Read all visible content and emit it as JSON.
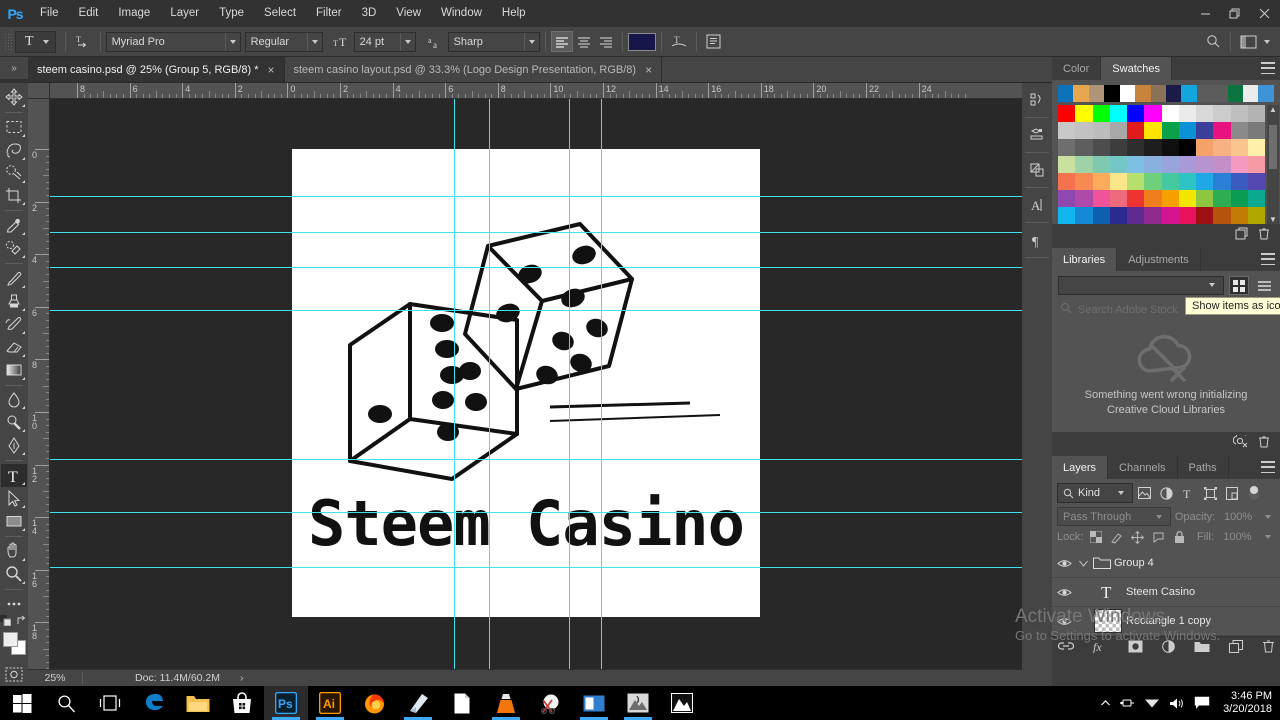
{
  "app": {
    "name": "Adobe Photoshop",
    "logo": "ps-logo"
  },
  "menubar": {
    "items": [
      "File",
      "Edit",
      "Image",
      "Layer",
      "Type",
      "Select",
      "Filter",
      "3D",
      "View",
      "Window",
      "Help"
    ]
  },
  "window_controls": {
    "minimize": "minimize-button",
    "restore": "restore-button",
    "close": "close-button"
  },
  "options_bar": {
    "tool": "T",
    "orientation_icon": "text-orientation-icon",
    "font_family": "Myriad Pro",
    "font_style": "Regular",
    "size_icon": "font-size-icon",
    "font_size": "24 pt",
    "antialias_icon": "anti-alias-icon",
    "anti_aliasing": "Sharp",
    "align": [
      "align-left",
      "align-center",
      "align-right"
    ],
    "active_align": "align-left",
    "text_color": "#16164a",
    "warp_icon": "warp-text-icon",
    "panel_icon": "character-paragraph-panels-icon",
    "search_icon": "search-icon",
    "workspace_icon": "workspace-switcher-icon"
  },
  "tabs": [
    {
      "title": "steem casino.psd @ 25% (Group 5, RGB/8) *",
      "active": true,
      "close": "×"
    },
    {
      "title": "steem casino layout.psd @ 33.3% (Logo  Design  Presentation, RGB/8)",
      "active": false,
      "close": "×"
    }
  ],
  "rulers": {
    "horizontal": [
      "8",
      "6",
      "4",
      "2",
      "0",
      "2",
      "4",
      "6",
      "8",
      "10",
      "12",
      "14",
      "16",
      "18",
      "20",
      "22",
      "24"
    ],
    "vertical": [
      "0",
      "2",
      "4",
      "6",
      "8",
      "10",
      "12",
      "14",
      "16",
      "18"
    ]
  },
  "canvas": {
    "artwork_title": "Steem Casino",
    "artwork_alt": "dice-logo"
  },
  "status_bar": {
    "zoom": "25%",
    "doc": "Doc: 11.4M/60.2M",
    "arrow": "›"
  },
  "toolbar": {
    "tools": [
      {
        "name": "move-tool",
        "glyph": "move"
      },
      {
        "name": "marquee-tool",
        "glyph": "marquee"
      },
      {
        "name": "lasso-tool",
        "glyph": "lasso"
      },
      {
        "name": "quick-selection-tool",
        "glyph": "quickselect"
      },
      {
        "name": "crop-tool",
        "glyph": "crop"
      },
      {
        "name": "eyedropper-tool",
        "glyph": "eyedropper"
      },
      {
        "name": "healing-brush-tool",
        "glyph": "heal"
      },
      {
        "name": "brush-tool",
        "glyph": "brush"
      },
      {
        "name": "clone-stamp-tool",
        "glyph": "stamp"
      },
      {
        "name": "history-brush-tool",
        "glyph": "historybrush"
      },
      {
        "name": "eraser-tool",
        "glyph": "eraser"
      },
      {
        "name": "gradient-tool",
        "glyph": "gradient"
      },
      {
        "name": "blur-tool",
        "glyph": "blur"
      },
      {
        "name": "dodge-tool",
        "glyph": "dodge"
      },
      {
        "name": "pen-tool",
        "glyph": "pen"
      },
      {
        "name": "type-tool",
        "glyph": "type",
        "active": true
      },
      {
        "name": "path-selection-tool",
        "glyph": "pathselect"
      },
      {
        "name": "rectangle-tool",
        "glyph": "rectangle"
      },
      {
        "name": "hand-tool",
        "glyph": "hand"
      },
      {
        "name": "zoom-tool",
        "glyph": "zoom"
      },
      {
        "name": "edit-toolbar-button",
        "glyph": "dots"
      }
    ],
    "swap_colors": "swap-colors-icon",
    "default_colors": "default-colors-icon",
    "quick_mask": "quick-mask-icon",
    "foreground_color": "#efefef",
    "background_color": "#ffffff"
  },
  "rail": {
    "icons": [
      "history-icon",
      "properties-icon",
      "styles-icon",
      "character-icon",
      "paragraph-icon"
    ]
  },
  "color_panel": {
    "tabs": [
      {
        "label": "Color",
        "active": false
      },
      {
        "label": "Swatches",
        "active": true
      }
    ],
    "menu": "panel-menu-icon",
    "recent": [
      "#0c72b9",
      "#e8a64f",
      "#b09477",
      "#000000",
      "#ffffff",
      "#c8833c",
      "#8a7259",
      "#1b1b4a",
      "#13a5dd",
      "#5c5c5c",
      "#5c5c5c",
      "#0c7440",
      "#ececec",
      "#3f94d8"
    ],
    "grid": [
      "#ff0000",
      "#ffff00",
      "#00ff00",
      "#00ffff",
      "#0000ff",
      "#ff00ff",
      "#ffffff",
      "#ebebeb",
      "#d9d9d9",
      "#cccccc",
      "#bfbfbf",
      "#b3b3b3",
      "#c8c8c8",
      "#c2c2c2",
      "#bcbcbc",
      "#a8a8a8",
      "#e01b1b",
      "#ffe400",
      "#0ba14a",
      "#0b92d6",
      "#3b3f99",
      "#e8117f",
      "#8a8a8a",
      "#7a7a7a",
      "#6e6e6e",
      "#5e5e5e",
      "#4d4d4d",
      "#3d3d3d",
      "#2e2e2e",
      "#1e1e1e",
      "#0f0f0f",
      "#000000",
      "#f4a26a",
      "#f7b283",
      "#f9c48e",
      "#fdf0a8",
      "#c8e0a0",
      "#9ed3a8",
      "#7ec9b0",
      "#74c7c7",
      "#7dc0e4",
      "#8ab0e0",
      "#9aa4dc",
      "#a79ad6",
      "#b794d0",
      "#c48fc6",
      "#f49ac1",
      "#f79aa5",
      "#f4734e",
      "#f78a52",
      "#fbab5a",
      "#fbe78a",
      "#b6df6e",
      "#6fcf7a",
      "#46c8a0",
      "#2fc4c4",
      "#1ea9e6",
      "#2b7fd4",
      "#3b5bc0",
      "#5348b0",
      "#8f48b0",
      "#b04aa8",
      "#f0539a",
      "#ef6a7c",
      "#ee3333",
      "#f07d1e",
      "#f5a000",
      "#f2e600",
      "#8dc63f",
      "#2fad52",
      "#0b9c53",
      "#0ba98e",
      "#12b6ef",
      "#1489d6",
      "#0d5fb0",
      "#2b2a8f",
      "#5e2a8f",
      "#902a8f",
      "#d4158f",
      "#e8125e",
      "#9c1016",
      "#b5530c",
      "#c27c05",
      "#b0a800"
    ],
    "new_swatch_icon": "new-swatch-icon",
    "delete_swatch_icon": "delete-swatch-icon"
  },
  "libraries_panel": {
    "tabs": [
      {
        "label": "Libraries",
        "active": true
      },
      {
        "label": "Adjustments",
        "active": false
      }
    ],
    "menu": "panel-menu-icon",
    "dropdown_value": "",
    "view_icons_tooltip": "Show items as icons",
    "search_placeholder": "Search Adobe Stock",
    "error_line1": "Something went wrong initializing",
    "error_line2": "Creative Cloud Libraries",
    "sync_icon": "cloud-error-icon",
    "delete_icon": "delete-icon"
  },
  "layers_panel": {
    "tabs": [
      {
        "label": "Layers",
        "active": true
      },
      {
        "label": "Channels",
        "active": false
      },
      {
        "label": "Paths",
        "active": false
      }
    ],
    "menu": "panel-menu-icon",
    "filter_label": "Kind",
    "filter_icons": [
      "filter-pixel-icon",
      "filter-adjustment-icon",
      "filter-type-icon",
      "filter-shape-icon",
      "filter-smartobject-icon"
    ],
    "filter_toggle": "filter-enable-toggle",
    "blend_mode": "Pass Through",
    "opacity_label": "Opacity:",
    "opacity_value": "100%",
    "lock_label": "Lock:",
    "lock_icons": [
      "lock-transparent-icon",
      "lock-image-icon",
      "lock-position-icon",
      "lock-artboard-icon",
      "lock-all-icon"
    ],
    "fill_label": "Fill:",
    "fill_value": "100%",
    "layers": [
      {
        "name": "Group 4",
        "type": "group",
        "visible": true,
        "expanded": true
      },
      {
        "name": "Steem Casino",
        "type": "text",
        "visible": true
      },
      {
        "name": "Rectangle 1 copy",
        "type": "shape",
        "visible": true
      }
    ],
    "footer_icons": [
      "link-layers-icon",
      "layer-style-fx-icon",
      "layer-mask-icon",
      "adjustment-layer-icon",
      "new-group-icon",
      "new-layer-icon",
      "delete-layer-icon"
    ]
  },
  "watermark": {
    "line1": "Activate Windows",
    "line2": "Go to Settings to activate Windows."
  },
  "taskbar": {
    "items": [
      {
        "name": "start-button",
        "glyph": "windows"
      },
      {
        "name": "search-button",
        "glyph": "search"
      },
      {
        "name": "task-view-button",
        "glyph": "taskview"
      },
      {
        "name": "edge-taskbar-icon",
        "glyph": "edge"
      },
      {
        "name": "file-explorer-taskbar-icon",
        "glyph": "folder"
      },
      {
        "name": "microsoft-store-taskbar-icon",
        "glyph": "store"
      },
      {
        "name": "photoshop-taskbar-icon",
        "glyph": "ps",
        "active": true,
        "running": true
      },
      {
        "name": "illustrator-taskbar-icon",
        "glyph": "ai",
        "running": true
      },
      {
        "name": "firefox-taskbar-icon",
        "glyph": "firefox"
      },
      {
        "name": "app-taskbar-icon",
        "glyph": "book",
        "running": true
      },
      {
        "name": "document-taskbar-icon",
        "glyph": "doc"
      },
      {
        "name": "vlc-taskbar-icon",
        "glyph": "vlc",
        "running": true
      },
      {
        "name": "snipping-tool-taskbar-icon",
        "glyph": "snip"
      },
      {
        "name": "office-taskbar-icon",
        "glyph": "office",
        "running": true
      },
      {
        "name": "media-taskbar-icon",
        "glyph": "media",
        "running": true
      },
      {
        "name": "photos-taskbar-icon",
        "glyph": "photos"
      }
    ],
    "tray": {
      "chevron": "show-hidden-icons",
      "icons": [
        "usb-icon",
        "wifi-icon",
        "volume-icon",
        "action-center-icon"
      ],
      "time": "3:46 PM",
      "date": "3/20/2018"
    }
  }
}
